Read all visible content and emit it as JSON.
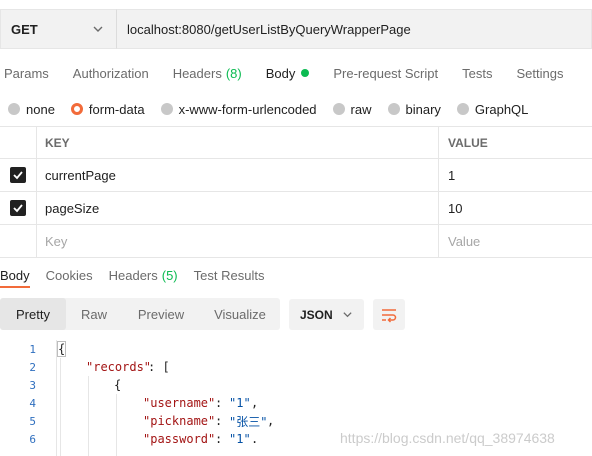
{
  "request": {
    "method": "GET",
    "url": "localhost:8080/getUserListByQueryWrapperPage"
  },
  "tabs": {
    "params": "Params",
    "authorization": "Authorization",
    "headers": "Headers",
    "headers_count": "(8)",
    "body": "Body",
    "prerequest": "Pre-request Script",
    "tests": "Tests",
    "settings": "Settings"
  },
  "body_types": {
    "none": "none",
    "form_data": "form-data",
    "urlencoded": "x-www-form-urlencoded",
    "raw": "raw",
    "binary": "binary",
    "graphql": "GraphQL",
    "selected": "form-data"
  },
  "params_table": {
    "headers": {
      "key": "KEY",
      "value": "VALUE"
    },
    "rows": [
      {
        "checked": true,
        "key": "currentPage",
        "value": "1"
      },
      {
        "checked": true,
        "key": "pageSize",
        "value": "10"
      }
    ],
    "placeholder": {
      "key": "Key",
      "value": "Value"
    }
  },
  "response_tabs": {
    "body": "Body",
    "cookies": "Cookies",
    "headers": "Headers",
    "headers_count": "(5)",
    "test_results": "Test Results"
  },
  "view_modes": {
    "pretty": "Pretty",
    "raw": "Raw",
    "preview": "Preview",
    "visualize": "Visualize",
    "active": "Pretty"
  },
  "format": "JSON",
  "code": {
    "line_numbers": [
      "1",
      "2",
      "3",
      "4",
      "5",
      "6"
    ],
    "l1": "{",
    "l2_key": "\"records\"",
    "l2_rest": ": [",
    "l3": "{",
    "l4_key": "\"username\"",
    "l4_val": "\"1\"",
    "l5_key": "\"pickname\"",
    "l5_val": "\"张三\"",
    "l6_key": "\"password\"",
    "l6_val": "\"1\""
  },
  "watermark": "https://blog.csdn.net/qq_38974638",
  "colors": {
    "accent": "#f26b3a",
    "success": "#0cbb52"
  }
}
